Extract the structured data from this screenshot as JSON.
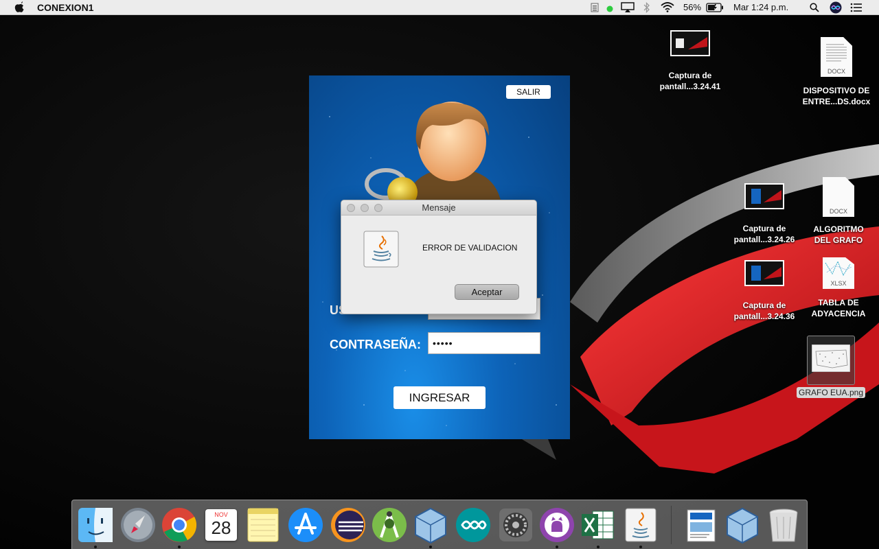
{
  "menubar": {
    "app_name": "CONEXION1",
    "battery": "56%",
    "clock": "Mar 1:24 p.m.",
    "icons": [
      "apple-icon",
      "battery-status-icon",
      "status-dot-icon",
      "airplay-icon",
      "bluetooth-icon",
      "wifi-icon",
      "battery-icon",
      "spotlight-icon",
      "siri-icon",
      "notification-center-icon"
    ]
  },
  "desktop": {
    "icons": [
      {
        "line1": "Captura de",
        "line2": "pantall...3.24.41"
      },
      {
        "line1": "DISPOSITIVO DE",
        "line2": "ENTRE...DS.docx",
        "ext": "DOCX"
      },
      {
        "line1": "Captura de",
        "line2": "pantall...3.24.26"
      },
      {
        "line1": "ALGORITMO",
        "line2": "DEL GRAFO",
        "ext": "DOCX"
      },
      {
        "line1": "Captura de",
        "line2": "pantall...3.24.36"
      },
      {
        "line1": "TABLA DE",
        "line2": "ADYACENCIA",
        "ext": "XLSX"
      },
      {
        "line1": "GRAFO EUA.png"
      }
    ]
  },
  "login": {
    "exit_label": "SALIR",
    "user_label": "USUARIO:",
    "password_label": "CONTRASEÑA:",
    "password_value": "•••••",
    "submit_label": "INGRESAR"
  },
  "dialog": {
    "title": "Mensaje",
    "message": "ERROR DE VALIDACION",
    "button": "Aceptar"
  },
  "dock": {
    "calendar_month": "NOV",
    "calendar_day": "28",
    "apps": [
      "Finder",
      "Launchpad",
      "Google Chrome",
      "Calendar",
      "Notes",
      "App Store",
      "Eclipse",
      "Android Studio",
      "VirtualBox",
      "Arduino",
      "System Preferences",
      "GitHub Desktop",
      "Microsoft Excel",
      "Java",
      "Document",
      "VirtualBox",
      "Trash"
    ]
  }
}
